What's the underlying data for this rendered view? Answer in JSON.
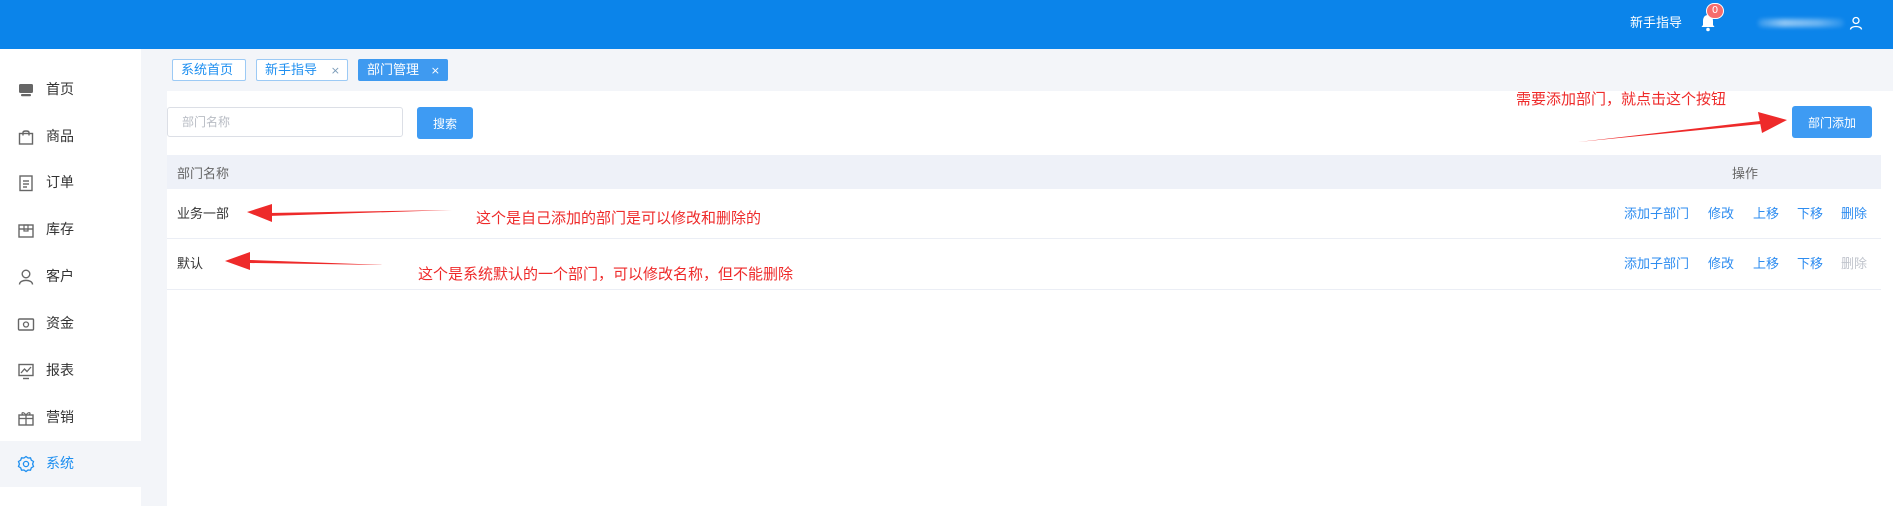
{
  "header": {
    "guide_label": "新手指导",
    "notification_count": "0",
    "bell_icon": "bell-icon",
    "user_icon": "user-icon",
    "accent_color": "#0b84ea"
  },
  "sidebar": {
    "active_color": "#1e8ff0",
    "items": [
      {
        "label": "首页",
        "icon": "home-icon"
      },
      {
        "label": "商品",
        "icon": "bag-icon"
      },
      {
        "label": "订单",
        "icon": "document-icon"
      },
      {
        "label": "库存",
        "icon": "box-icon"
      },
      {
        "label": "客户",
        "icon": "person-icon"
      },
      {
        "label": "资金",
        "icon": "money-icon"
      },
      {
        "label": "报表",
        "icon": "chart-icon"
      },
      {
        "label": "营销",
        "icon": "gift-icon"
      },
      {
        "label": "系统",
        "icon": "gear-icon",
        "active": true
      }
    ]
  },
  "tabs": [
    {
      "label": "系统首页",
      "closable": false
    },
    {
      "label": "新手指导",
      "closable": true,
      "close": "×"
    },
    {
      "label": "部门管理",
      "closable": true,
      "close": "×",
      "active": true
    }
  ],
  "toolbar": {
    "search_placeholder": "部门名称",
    "search_value": "",
    "search_button": "搜索",
    "add_button": "部门添加"
  },
  "table": {
    "headers": {
      "name": "部门名称",
      "ops": "操作"
    },
    "rows": [
      {
        "name": "业务一部",
        "ops": [
          "添加子部门",
          "修改",
          "上移",
          "下移",
          "删除"
        ],
        "delete_disabled": false
      },
      {
        "name": "默认",
        "ops": [
          "添加子部门",
          "修改",
          "上移",
          "下移",
          "删除"
        ],
        "delete_disabled": true
      }
    ]
  },
  "annotations": {
    "add_hint": "需要添加部门，就点击这个按钮",
    "row1_hint": "这个是自己添加的部门是可以修改和删除的",
    "row2_hint": "这个是系统默认的一个部门，可以修改名称，但不能删除",
    "color": "#ee2a2a"
  }
}
